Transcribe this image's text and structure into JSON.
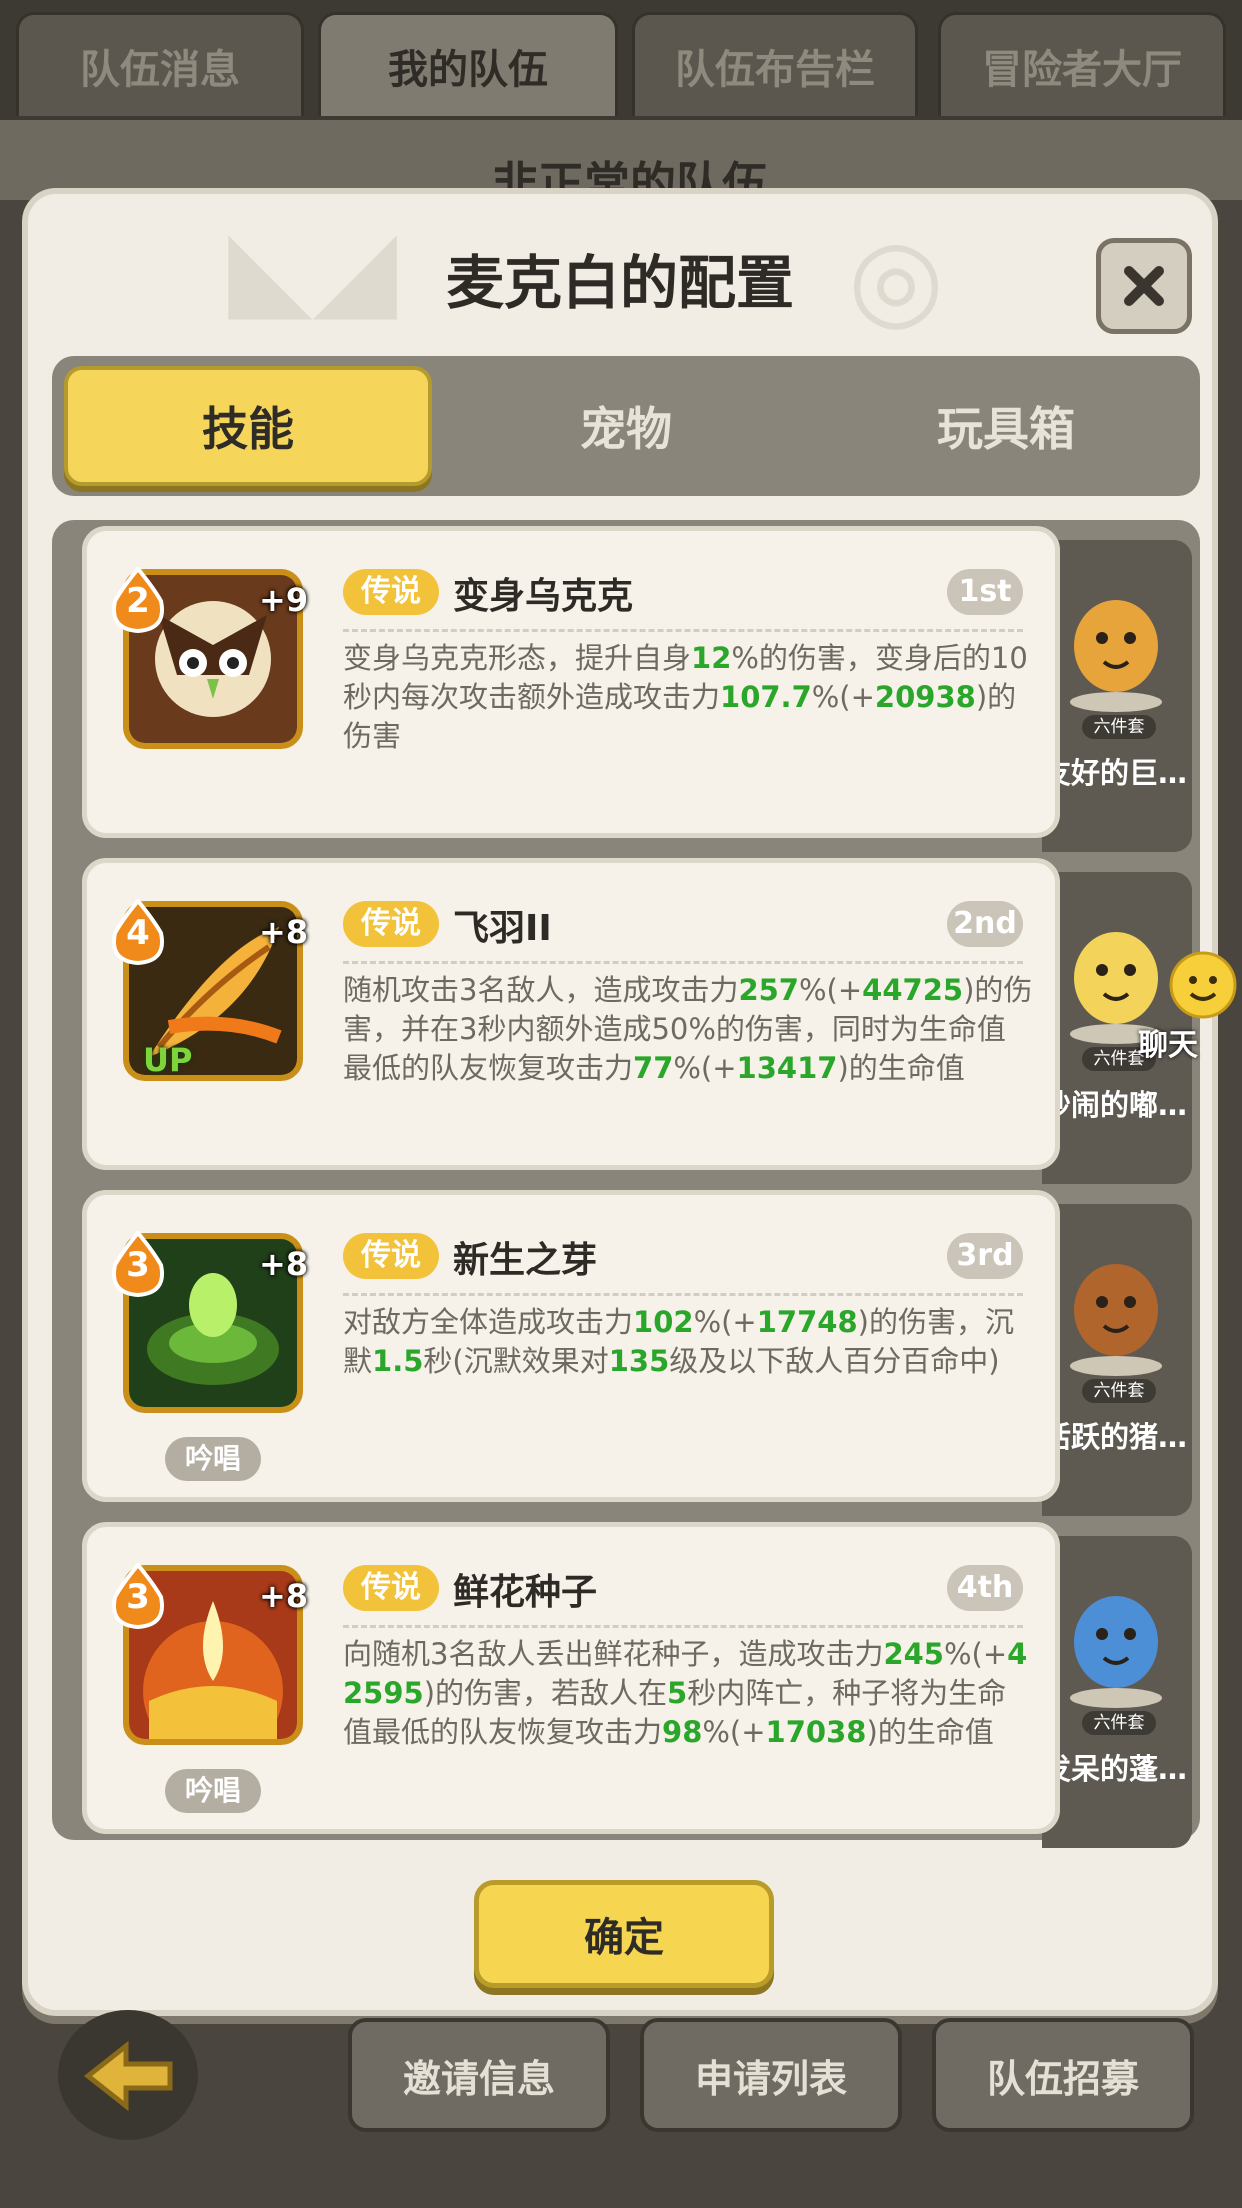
{
  "top_tabs": [
    "队伍消息",
    "我的队伍",
    "队伍布告栏",
    "冒险者大厅"
  ],
  "background_title": "非正常的队伍",
  "modal": {
    "title": "麦克白的配置",
    "tabs": [
      "技能",
      "宠物",
      "玩具箱"
    ],
    "active_tab": "技能",
    "skills": [
      {
        "level": "2",
        "plus": "+9",
        "rarity": "传说",
        "name": "变身乌克克",
        "rank": "1st",
        "chant": "",
        "up": false,
        "desc": [
          [
            "变身乌克克形态，提升自身",
            ""
          ],
          [
            "12",
            "g"
          ],
          [
            "%的伤害，变身后的10秒内每次攻击额外造成攻击力",
            ""
          ],
          [
            "107.7",
            "g"
          ],
          [
            "%(+",
            ""
          ],
          [
            "20938",
            "g"
          ],
          [
            ")的伤害",
            ""
          ]
        ]
      },
      {
        "level": "4",
        "plus": "+8",
        "rarity": "传说",
        "name": "飞羽II",
        "rank": "2nd",
        "chant": "",
        "up": true,
        "up_label": "UP",
        "desc": [
          [
            "随机攻击3名敌人，造成攻击力",
            ""
          ],
          [
            "257",
            "g"
          ],
          [
            "%(+",
            ""
          ],
          [
            "44725",
            "g"
          ],
          [
            ")的伤害，并在3秒内额外造成50%的伤害，同时为生命值最低的队友恢复攻击力",
            ""
          ],
          [
            "77",
            "g"
          ],
          [
            "%(+",
            ""
          ],
          [
            "13417",
            "g"
          ],
          [
            ")的生命值",
            ""
          ]
        ]
      },
      {
        "level": "3",
        "plus": "+8",
        "rarity": "传说",
        "name": "新生之芽",
        "rank": "3rd",
        "chant": "吟唱",
        "up": false,
        "desc": [
          [
            "对敌方全体造成攻击力",
            ""
          ],
          [
            "102",
            "g"
          ],
          [
            "%(+",
            ""
          ],
          [
            "17748",
            "g"
          ],
          [
            ")的伤害，沉默",
            ""
          ],
          [
            "1.5",
            "g"
          ],
          [
            "秒(沉默效果对",
            ""
          ],
          [
            "135",
            "g"
          ],
          [
            "级及以下敌人百分百命中)",
            ""
          ]
        ]
      },
      {
        "level": "3",
        "plus": "+8",
        "rarity": "传说",
        "name": "鲜花种子",
        "rank": "4th",
        "chant": "吟唱",
        "up": false,
        "desc": [
          [
            "向随机3名敌人丢出鲜花种子，造成攻击力",
            ""
          ],
          [
            "245",
            "g"
          ],
          [
            "%(+",
            ""
          ],
          [
            "42595",
            "g"
          ],
          [
            ")的伤害，若敌人在",
            ""
          ],
          [
            "5",
            "g"
          ],
          [
            "秒内阵亡，种子将为生命值最低的队友恢复攻击力",
            ""
          ],
          [
            "98",
            "g"
          ],
          [
            "%(+",
            ""
          ],
          [
            "17038",
            "g"
          ],
          [
            ")的生命值",
            ""
          ]
        ]
      }
    ],
    "pets": [
      {
        "name": "友好的巨…",
        "badge": "六件套",
        "color": "#e6a43a",
        "sign": "WIN"
      },
      {
        "name": "吵闹的嘟…",
        "badge": "六件套",
        "color": "#f3d35a",
        "sign": ""
      },
      {
        "name": "活跃的猪…",
        "badge": "六件套",
        "color": "#b0652d",
        "sign": ""
      },
      {
        "name": "发呆的蓬…",
        "badge": "六件套",
        "color": "#4d8fd6",
        "sign": ""
      }
    ],
    "confirm_label": "确定"
  },
  "chat_label": "聊天",
  "bottom_buttons": [
    "邀请信息",
    "申请列表",
    "队伍招募"
  ]
}
